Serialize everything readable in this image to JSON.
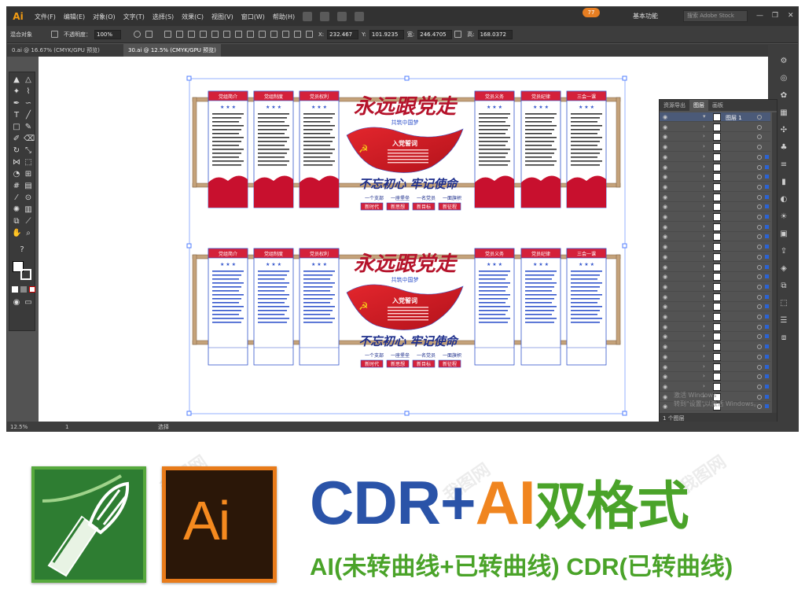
{
  "app": {
    "logo": "Ai",
    "menu": [
      "文件(F)",
      "编辑(E)",
      "对象(O)",
      "文字(T)",
      "选择(S)",
      "效果(C)",
      "视图(V)",
      "窗口(W)",
      "帮助(H)"
    ],
    "update_badge": "77",
    "workspace": "基本功能",
    "stock_search_placeholder": "搜索 Adobe Stock",
    "window_controls": [
      "—",
      "❐",
      "✕"
    ]
  },
  "control_bar": {
    "object_type": "混合对象",
    "opacity_label": "不透明度：",
    "opacity_value": "100%",
    "x_label": "X:",
    "x_value": "232.467",
    "y_label": "Y:",
    "y_value": "101.9235",
    "w_label": "宽:",
    "w_value": "246.4705",
    "h_label": "高:",
    "h_value": "168.0372"
  },
  "document_tabs": [
    {
      "label": "0.ai @ 16.67% (CMYK/GPU 预览)",
      "active": false
    },
    {
      "label": "30.ai @ 12.5% (CMYK/GPU 预览)",
      "active": true
    }
  ],
  "artwork": {
    "top": {
      "headline": "永远跟党走",
      "subline": "共筑中国梦",
      "flag_label": "入党誓词",
      "slogan": "不忘初心 牢记使命",
      "pledges": [
        "一个支部",
        "一座堡垒",
        "一名党员",
        "一面旗帜"
      ],
      "tags": [
        "新时代",
        "新思想",
        "新目标",
        "新征程"
      ],
      "panels": [
        "党组简介",
        "党组制度",
        "党员权利",
        "党员义务",
        "党员纪律",
        "三会一课"
      ]
    },
    "bottom": {
      "headline": "永远跟党走",
      "subline": "共筑中国梦",
      "flag_label": "入党誓词",
      "slogan": "不忘初心 牢记使命",
      "pledges": [
        "一个支部",
        "一座堡垒",
        "一名党员",
        "一面旗帜"
      ],
      "tags": [
        "新时代",
        "新思想",
        "新目标",
        "新征程"
      ],
      "panels": [
        "党组简介",
        "党组制度",
        "党员权利",
        "党员义务",
        "党员纪律",
        "三会一课"
      ]
    }
  },
  "layers_panel": {
    "tabs": [
      {
        "label": "资源导出",
        "active": false
      },
      {
        "label": "图层",
        "active": true
      },
      {
        "label": "画板",
        "active": false
      }
    ],
    "top_layer": "图层 1",
    "footer": "1 个图层",
    "row_count": 30
  },
  "status_bar": {
    "zoom": "12.5%",
    "page": "1",
    "tool_mode": "选择"
  },
  "windows_watermark": {
    "line1": "激活 Windows",
    "line2": "转到\"设置\"以激活 Windows。"
  },
  "banner": {
    "title_cdr": "CDR",
    "title_plus": "+",
    "title_ai": "AI",
    "title_format": "双格式",
    "subtitle": "AI(未转曲线+已转曲线) CDR(已转曲线)",
    "ai_logo_text": "Ai",
    "colors": {
      "cdr_blue": "#2a53a8",
      "ai_orange": "#f0851f",
      "format_green": "#4aa329"
    }
  },
  "site_watermark": "我图网"
}
